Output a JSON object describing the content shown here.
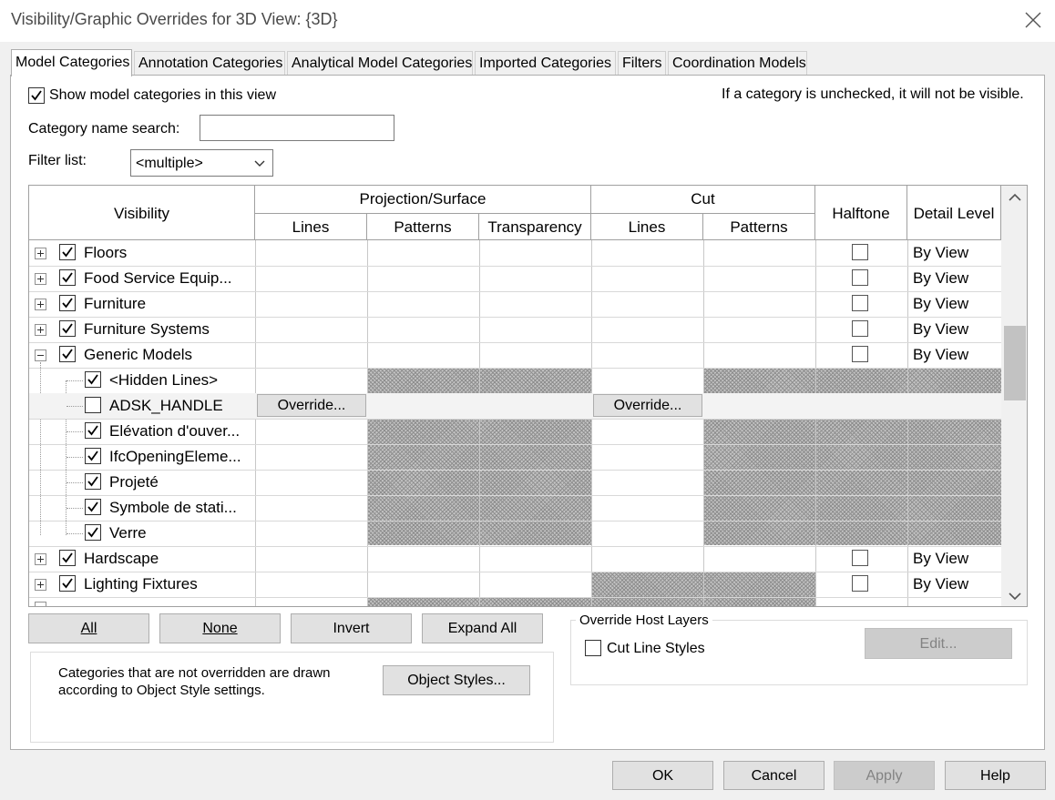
{
  "window": {
    "title": "Visibility/Graphic Overrides for 3D View: {3D}"
  },
  "tabs": [
    {
      "label": "Model Categories"
    },
    {
      "label": "Annotation Categories"
    },
    {
      "label": "Analytical Model Categories"
    },
    {
      "label": "Imported Categories"
    },
    {
      "label": "Filters"
    },
    {
      "label": "Coordination Models"
    }
  ],
  "options": {
    "show_label": "Show model categories in this view",
    "hint": "If a category is unchecked, it will not be visible.",
    "search_label": "Category name search:",
    "search_value": "",
    "filter_label": "Filter list:",
    "filter_value": "<multiple>"
  },
  "grid": {
    "headers": {
      "visibility": "Visibility",
      "projection": "Projection/Surface",
      "cut": "Cut",
      "halftone": "Halftone",
      "detail": "Detail Level",
      "lines": "Lines",
      "patterns": "Patterns",
      "transparency": "Transparency",
      "cut_lines": "Lines",
      "cut_patterns": "Patterns"
    },
    "rows": [
      {
        "name": "Floors",
        "checked": true,
        "level": 0,
        "expander": "plus",
        "detail": "By View"
      },
      {
        "name": "Food Service Equip...",
        "checked": true,
        "level": 0,
        "expander": "plus",
        "detail": "By View"
      },
      {
        "name": "Furniture",
        "checked": true,
        "level": 0,
        "expander": "plus",
        "detail": "By View"
      },
      {
        "name": "Furniture Systems",
        "checked": true,
        "level": 0,
        "expander": "plus",
        "detail": "By View"
      },
      {
        "name": "Generic Models",
        "checked": true,
        "level": 0,
        "expander": "minus",
        "detail": "By View"
      },
      {
        "name": "<Hidden Lines>",
        "checked": true,
        "level": 1
      },
      {
        "name": "ADSK_HANDLE",
        "checked": false,
        "level": 1,
        "override_proj": "Override...",
        "override_cut": "Override..."
      },
      {
        "name": "Elévation d'ouver...",
        "checked": true,
        "level": 1
      },
      {
        "name": "IfcOpeningEleme...",
        "checked": true,
        "level": 1
      },
      {
        "name": "Projeté",
        "checked": true,
        "level": 1
      },
      {
        "name": "Symbole de stati...",
        "checked": true,
        "level": 1
      },
      {
        "name": "Verre",
        "checked": true,
        "level": 1
      },
      {
        "name": "Hardscape",
        "checked": true,
        "level": 0,
        "expander": "plus",
        "detail": "By View"
      },
      {
        "name": "Lighting Fixtures",
        "checked": true,
        "level": 0,
        "expander": "plus",
        "detail": "By View"
      }
    ]
  },
  "buttons": {
    "all": "All",
    "none": "None",
    "invert": "Invert",
    "expand_all": "Expand All",
    "object_styles": "Object Styles...",
    "edit": "Edit...",
    "ok": "OK",
    "cancel": "Cancel",
    "apply": "Apply",
    "help": "Help"
  },
  "info_text_1": "Categories that are not overridden are drawn",
  "info_text_2": "according to Object Style settings.",
  "host_layers": {
    "title": "Override Host Layers",
    "cut_line_styles": "Cut Line Styles"
  }
}
